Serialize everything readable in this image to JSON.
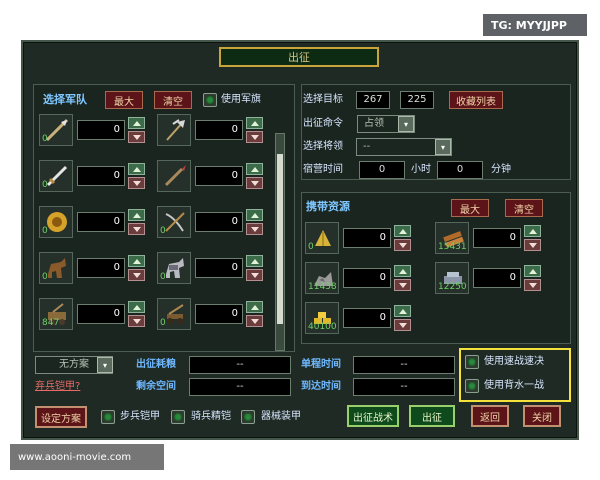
{
  "watermark_top": "TG: MYYJJPP",
  "watermark_bottom": "www.aooni-movie.com",
  "title": "出征",
  "army": {
    "header": "选择军队",
    "max_label": "最大",
    "clear_label": "清空",
    "use_flag_label": "使用军旗",
    "units": [
      {
        "icon": "spearman-icon",
        "count": "0",
        "value": "0"
      },
      {
        "icon": "halberd-icon",
        "count": "",
        "value": "0"
      },
      {
        "icon": "swordsman-icon",
        "count": "0",
        "value": "0"
      },
      {
        "icon": "lancer-icon",
        "count": "",
        "value": "0"
      },
      {
        "icon": "shield-icon",
        "count": "0",
        "value": "0"
      },
      {
        "icon": "crossbow-icon",
        "count": "0",
        "value": "0"
      },
      {
        "icon": "horse-icon",
        "count": "0",
        "value": "0"
      },
      {
        "icon": "armored-horse-icon",
        "count": "0",
        "value": "0"
      },
      {
        "icon": "siege-icon",
        "count": "847",
        "value": "0"
      },
      {
        "icon": "catapult-icon",
        "count": "0",
        "value": "0"
      }
    ]
  },
  "target": {
    "label": "选择目标",
    "x": "267",
    "y": "225",
    "favorites_label": "收藏列表",
    "command_label": "出征命令",
    "command_value": "占领",
    "general_label": "选择将领",
    "general_value": "--",
    "camp_time_label": "宿营时间",
    "hours": "0",
    "hours_unit": "小时",
    "minutes": "0",
    "minutes_unit": "分钟"
  },
  "resources": {
    "header": "携带资源",
    "max_label": "最大",
    "clear_label": "清空",
    "items": [
      {
        "icon": "grain-icon",
        "count": "0",
        "value": "0"
      },
      {
        "icon": "wood-icon",
        "count": "15431",
        "value": "0"
      },
      {
        "icon": "stone-icon",
        "count": "11438",
        "value": "0"
      },
      {
        "icon": "iron-icon",
        "count": "12250",
        "value": "0"
      },
      {
        "icon": "gold-icon",
        "count": "40100",
        "value": "0"
      }
    ]
  },
  "bottom": {
    "plan_value": "无方案",
    "armor_link": "弃兵铠甲?",
    "expedition_grain_label": "出征耗粮",
    "expedition_grain_value": "--",
    "remaining_space_label": "剩余空间",
    "remaining_space_value": "--",
    "one_way_label": "单程时间",
    "one_way_value": "--",
    "arrival_label": "到达时间",
    "arrival_value": "--",
    "speed_option": "使用速战速决",
    "last_stand_option": "使用背水一战",
    "set_plan_label": "设定方案",
    "infantry_armor": "步兵铠甲",
    "cavalry_armor": "骑兵精铠",
    "machine_armor": "器械装甲",
    "tactics_label": "出征战术",
    "depart_label": "出征",
    "back_label": "返回",
    "close_label": "关闭"
  }
}
